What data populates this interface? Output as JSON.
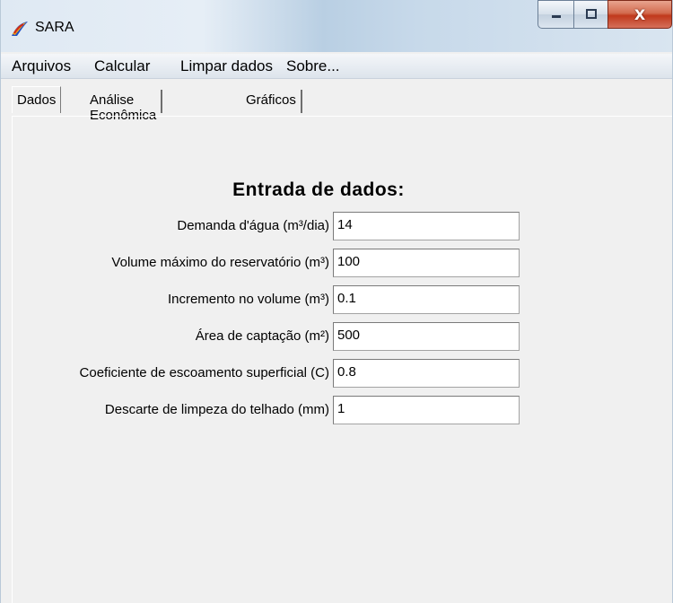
{
  "window": {
    "title": "SARA",
    "icon": "sara-app-icon"
  },
  "caption_buttons": {
    "minimize_icon": "minimize-icon",
    "maximize_icon": "maximize-icon",
    "close_label": "X"
  },
  "menu": [
    {
      "label": "Arquivos"
    },
    {
      "label": "Calcular"
    },
    {
      "label": "Limpar dados"
    },
    {
      "label": "Sobre..."
    }
  ],
  "tabs": [
    {
      "label": "Dados",
      "active": true
    },
    {
      "label": "Análise Econômica",
      "active": false
    },
    {
      "label": "Gráficos",
      "active": false
    }
  ],
  "form": {
    "heading": "Entrada de dados:",
    "fields": [
      {
        "label": "Demanda d'água (m³/dia)",
        "value": "14"
      },
      {
        "label": "Volume máximo do reservatório (m³)",
        "value": "100"
      },
      {
        "label": "Incremento no volume (m³)",
        "value": "0.1"
      },
      {
        "label": "Área de captação (m²)",
        "value": "500"
      },
      {
        "label": "Coeficiente de escoamento superficial (C)",
        "value": "0.8"
      },
      {
        "label": "Descarte de limpeza do telhado (mm)",
        "value": "1"
      }
    ]
  },
  "colors": {
    "window_bg": "#f0f0f0",
    "close_button": "#c0391c"
  }
}
